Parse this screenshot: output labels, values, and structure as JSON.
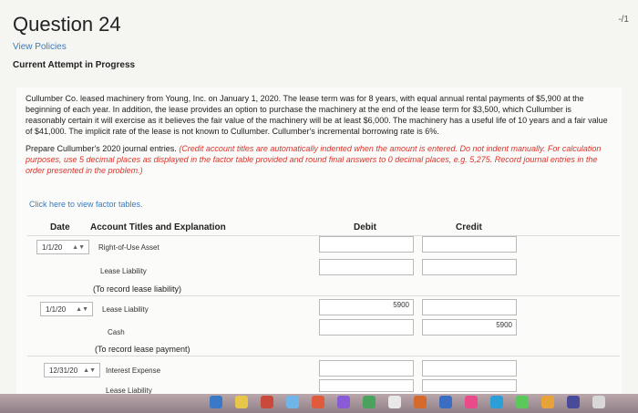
{
  "header": {
    "title": "Question 24",
    "score": "-/1",
    "view_policies": "View Policies",
    "attempt_status": "Current Attempt in Progress"
  },
  "problem": {
    "text": "Cullumber Co. leased machinery from Young, Inc. on January 1, 2020. The lease term was for 8 years, with equal annual rental payments of $5,900 at the beginning of each year. In addition, the lease provides an option to purchase the machinery at the end of the lease term for $3,500, which Cullumber is reasonably certain it will exercise as it believes the fair value of the machinery will be at least $6,000. The machinery has a useful life of 10 years and a fair value of $41,000. The implicit rate of the lease is not known to Cullumber. Cullumber's incremental borrowing rate is 6%.",
    "instruction_plain": "Prepare Cullumber's 2020 journal entries. ",
    "instruction_red": "(Credit account titles are automatically indented when the amount is entered. Do not indent manually. For calculation purposes, use 5 decimal places as displayed in the factor table provided and round final answers to 0 decimal places, e.g. 5,275. Record journal entries in the order presented in the problem.)",
    "factor_link": "Click here to view factor tables."
  },
  "table": {
    "col_date": "Date",
    "col_account": "Account Titles and Explanation",
    "col_debit": "Debit",
    "col_credit": "Credit",
    "entries": [
      {
        "date": "1/1/20",
        "lines": [
          {
            "account": "Right-of-Use Asset",
            "debit": "",
            "credit": ""
          },
          {
            "account": "Lease Liability",
            "debit": "",
            "credit": ""
          }
        ],
        "memo": "(To record lease liability)"
      },
      {
        "date": "1/1/20",
        "lines": [
          {
            "account": "Lease Liability",
            "debit": "5900",
            "credit": ""
          },
          {
            "account": "Cash",
            "debit": "",
            "credit": "5900"
          }
        ],
        "memo": "(To record lease payment)"
      },
      {
        "date": "12/31/20",
        "lines": [
          {
            "account": "Interest Expense",
            "debit": "",
            "credit": ""
          },
          {
            "account": "Lease Liability",
            "debit": "",
            "credit": ""
          }
        ],
        "memo": ""
      }
    ]
  },
  "dock": {
    "colors": [
      "#3a78c8",
      "#e8c64a",
      "#c94a3a",
      "#6fb5e8",
      "#e05a3c",
      "#8a5bd6",
      "#4aa35c",
      "#e8e8e8",
      "#d66a2c",
      "#3b6ec2",
      "#e84a8a",
      "#2c9fd8",
      "#5ac85a",
      "#e8a23a",
      "#4a4a9a",
      "#d8d8d8"
    ]
  }
}
